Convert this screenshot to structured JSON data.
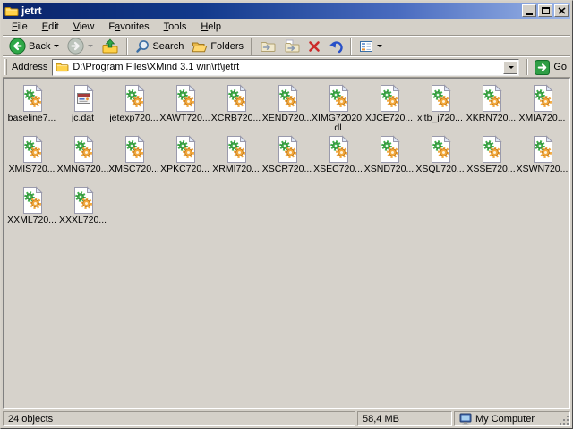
{
  "window": {
    "title": "jetrt"
  },
  "menubar": {
    "items": [
      {
        "label": "File",
        "u": 0
      },
      {
        "label": "Edit",
        "u": 0
      },
      {
        "label": "View",
        "u": 0
      },
      {
        "label": "Favorites",
        "u": 1
      },
      {
        "label": "Tools",
        "u": 0
      },
      {
        "label": "Help",
        "u": 0
      }
    ]
  },
  "toolbar": {
    "back_label": "Back",
    "search_label": "Search",
    "folders_label": "Folders"
  },
  "addressbar": {
    "label": "Address",
    "path": "D:\\Program Files\\XMind 3.1 win\\rt\\jetrt",
    "go_label": "Go"
  },
  "files": [
    {
      "label": "baseline7...",
      "icon": "dll"
    },
    {
      "label": "jc.dat",
      "icon": "dat"
    },
    {
      "label": "jetexp720...",
      "icon": "dll"
    },
    {
      "label": "XAWT720...",
      "icon": "dll"
    },
    {
      "label": "XCRB720...",
      "icon": "dll"
    },
    {
      "label": "XEND720...",
      "icon": "dll"
    },
    {
      "label": "XIMG72020.\ndl",
      "icon": "dll"
    },
    {
      "label": "XJCE720...",
      "icon": "dll"
    },
    {
      "label": "xjtb_j720...",
      "icon": "dll"
    },
    {
      "label": "XKRN720...",
      "icon": "dll"
    },
    {
      "label": "XMIA720...",
      "icon": "dll"
    },
    {
      "label": "XMIS720...",
      "icon": "dll"
    },
    {
      "label": "XMNG720...",
      "icon": "dll"
    },
    {
      "label": "XMSC720...",
      "icon": "dll"
    },
    {
      "label": "XPKC720...",
      "icon": "dll"
    },
    {
      "label": "XRMI720...",
      "icon": "dll"
    },
    {
      "label": "XSCR720...",
      "icon": "dll"
    },
    {
      "label": "XSEC720...",
      "icon": "dll"
    },
    {
      "label": "XSND720...",
      "icon": "dll"
    },
    {
      "label": "XSQL720...",
      "icon": "dll"
    },
    {
      "label": "XSSE720...",
      "icon": "dll"
    },
    {
      "label": "XSWN720...",
      "icon": "dll"
    },
    {
      "label": "XXML720...",
      "icon": "dll"
    },
    {
      "label": "XXXL720...",
      "icon": "dll"
    }
  ],
  "statusbar": {
    "objects": "24 objects",
    "size": "58,4 MB",
    "location": "My Computer"
  },
  "colors": {
    "title_gradient_start": "#0A246A",
    "title_gradient_end": "#9CB6E8",
    "chrome": "#D4D0C8",
    "content_bg": "#D6D2CB",
    "back_green": "#2FA848",
    "delete_red": "#CC2A2A",
    "undo_blue": "#2850C8",
    "go_green": "#2F9E45"
  }
}
